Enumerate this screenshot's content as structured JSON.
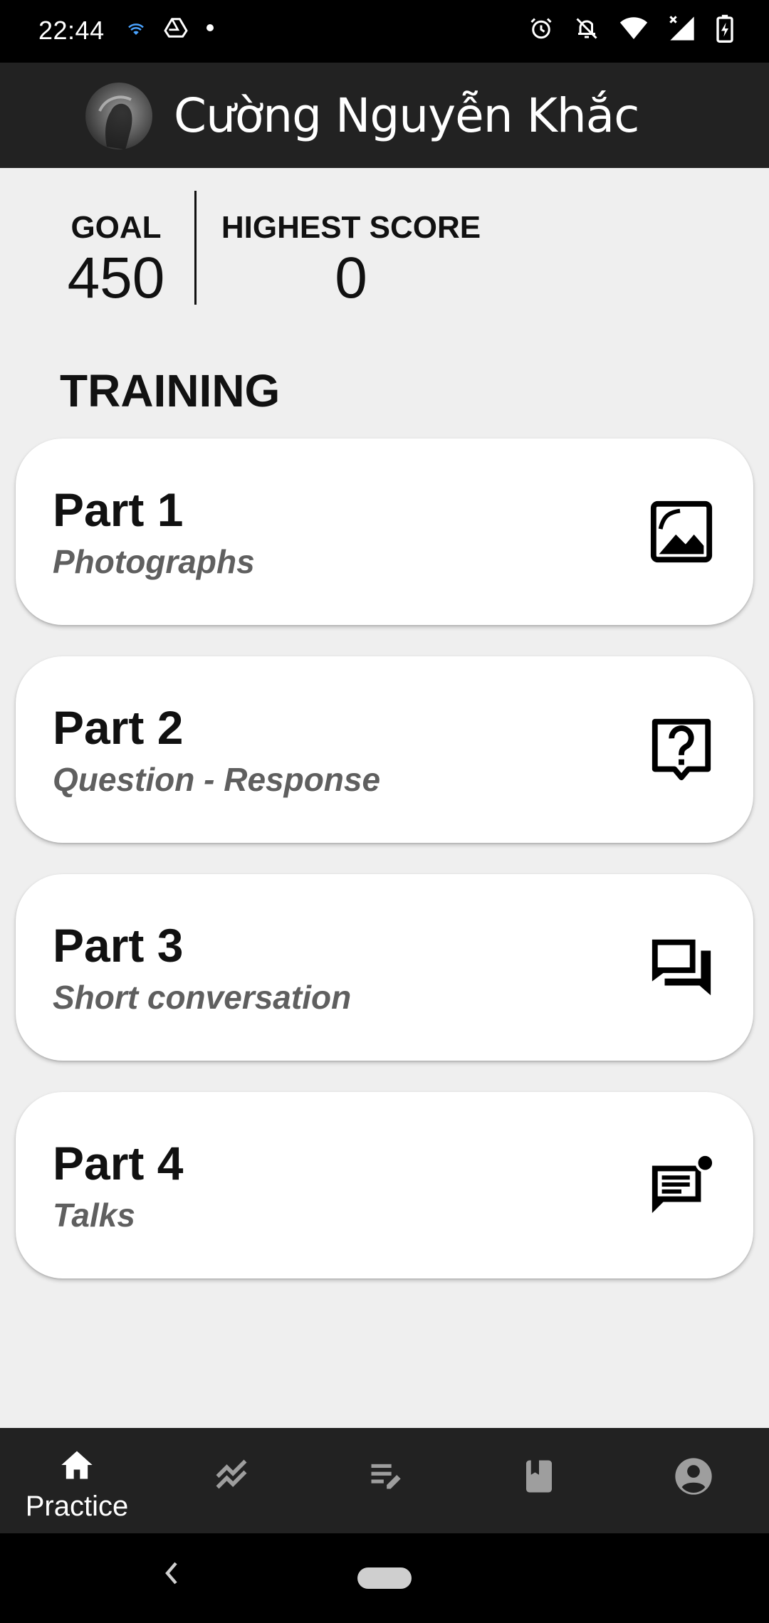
{
  "status_bar": {
    "time": "22:44",
    "icons_left": [
      "wifi-calling-icon",
      "drive-icon",
      "dot-icon"
    ],
    "icons_right": [
      "alarm-icon",
      "notifications-off-icon",
      "wifi-icon",
      "signal-icon",
      "battery-charging-icon"
    ]
  },
  "header": {
    "user_name": "Cường Nguyễn Khắc"
  },
  "stats": {
    "goal_label": "GOAL",
    "goal_value": "450",
    "highest_label": "HIGHEST SCORE",
    "highest_value": "0"
  },
  "training": {
    "section_title": "TRAINING",
    "parts": [
      {
        "title": "Part 1",
        "subtitle": "Photographs",
        "icon": "photo-icon"
      },
      {
        "title": "Part 2",
        "subtitle": "Question - Response",
        "icon": "question-bubble-icon"
      },
      {
        "title": "Part 3",
        "subtitle": "Short conversation",
        "icon": "forum-icon"
      },
      {
        "title": "Part 4",
        "subtitle": "Talks",
        "icon": "announcement-icon"
      }
    ]
  },
  "bottom_nav": {
    "items": [
      {
        "label": "Practice",
        "icon": "home-icon",
        "active": true
      },
      {
        "label": "",
        "icon": "stats-icon",
        "active": false
      },
      {
        "label": "",
        "icon": "edit-list-icon",
        "active": false
      },
      {
        "label": "",
        "icon": "book-icon",
        "active": false
      },
      {
        "label": "",
        "icon": "account-icon",
        "active": false
      }
    ]
  },
  "colors": {
    "app_bar": "#222222",
    "background": "#efefef",
    "card": "#ffffff",
    "subtitle": "#5f5f5f"
  }
}
